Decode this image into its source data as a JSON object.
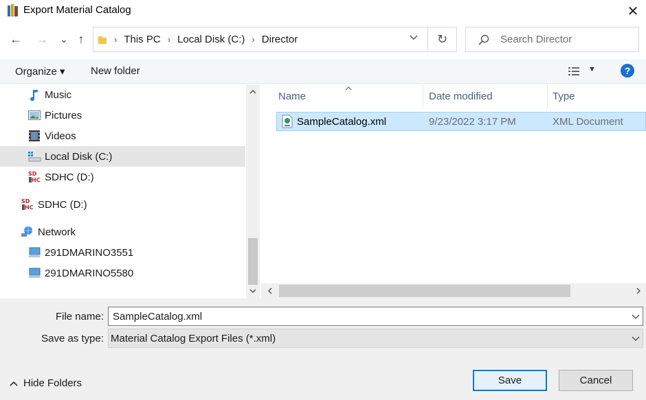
{
  "window": {
    "title": "Export Material Catalog",
    "close_glyph": "✕"
  },
  "nav": {
    "back_glyph": "←",
    "forward_glyph": "→",
    "recent_glyph": "⌄",
    "up_glyph": "↑",
    "breadcrumb": [
      "This PC",
      "Local Disk (C:)",
      "Director"
    ],
    "separator": "›",
    "refresh_glyph": "↻",
    "search_placeholder": "Search Director"
  },
  "toolbar": {
    "organize_label": "Organize ▾",
    "new_folder_label": "New folder",
    "view_dropdown_glyph": "▼",
    "help_glyph": "?"
  },
  "sidebar": {
    "items": [
      {
        "label": "Music",
        "icon": "music-note-icon"
      },
      {
        "label": "Pictures",
        "icon": "pictures-icon"
      },
      {
        "label": "Videos",
        "icon": "videos-icon"
      },
      {
        "label": "Local Disk (C:)",
        "icon": "local-disk-icon",
        "selected": true
      },
      {
        "label": "SDHC (D:)",
        "icon": "sd-card-icon"
      },
      {
        "label": "SDHC (D:)",
        "icon": "sd-card-icon"
      },
      {
        "label": "Network",
        "icon": "network-icon"
      },
      {
        "label": "291DMARINO3551",
        "icon": "computer-icon"
      },
      {
        "label": "291DMARINO5580",
        "icon": "computer-icon"
      }
    ]
  },
  "files": {
    "columns": [
      "Name",
      "Date modified",
      "Type"
    ],
    "rows": [
      {
        "name": "SampleCatalog.xml",
        "date": "9/23/2022 3:17 PM",
        "type": "XML Document",
        "selected": true
      }
    ]
  },
  "form": {
    "file_name_label": "File name:",
    "file_name_value": "SampleCatalog.xml",
    "save_type_label": "Save as type:",
    "save_type_value": "Material Catalog Export Files (*.xml)"
  },
  "footer": {
    "hide_folders_label": "Hide Folders",
    "save_label": "Save",
    "cancel_label": "Cancel"
  },
  "colors": {
    "accent": "#0078d7",
    "selection": "#cce8ff",
    "help": "#1a6fd0"
  }
}
